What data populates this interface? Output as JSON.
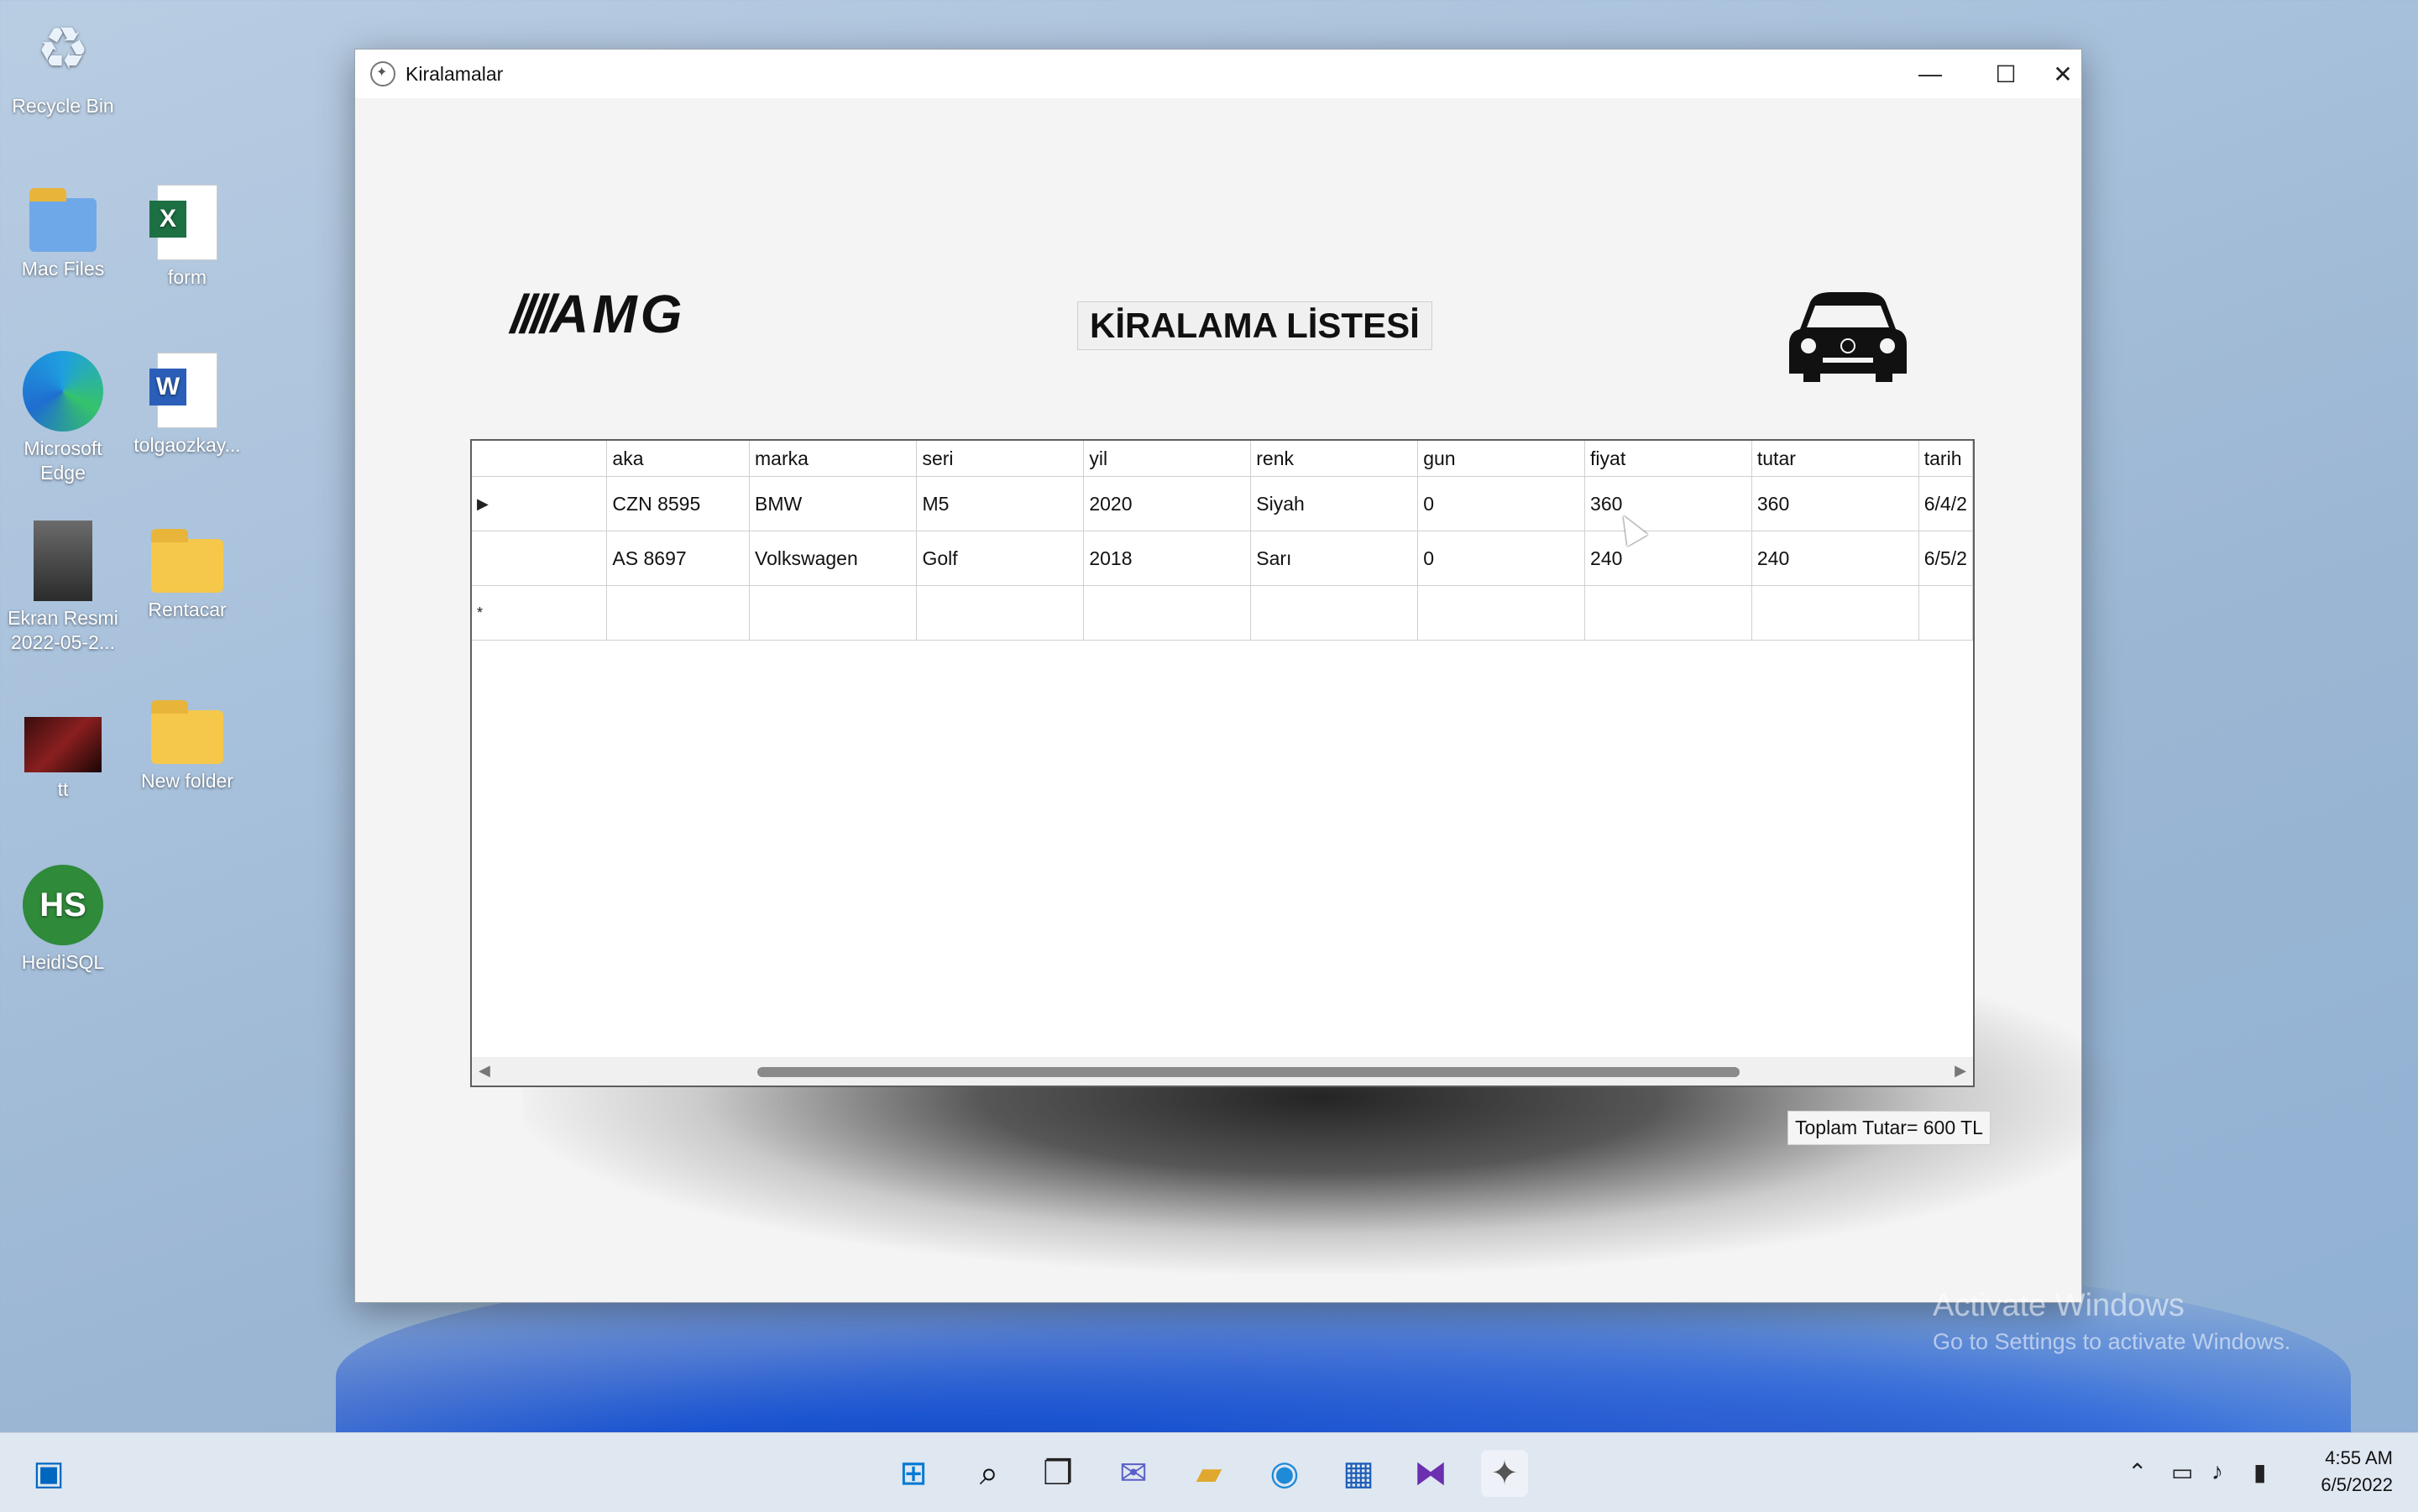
{
  "desktop": {
    "icons": [
      {
        "label": "Recycle Bin",
        "icon": "recycle-bin-icon"
      },
      {
        "label": "Mac Files",
        "icon": "folder-icon"
      },
      {
        "label": "form",
        "icon": "excel-file-icon"
      },
      {
        "label": "Microsoft Edge",
        "icon": "edge-icon"
      },
      {
        "label": "tolgaozkay...",
        "icon": "word-file-icon"
      },
      {
        "label": "Ekran Resmi 2022-05-2...",
        "icon": "image-file-icon"
      },
      {
        "label": "Rentacar",
        "icon": "folder-icon"
      },
      {
        "label": "tt",
        "icon": "image-file-icon"
      },
      {
        "label": "New folder",
        "icon": "folder-icon"
      },
      {
        "label": "HeidiSQL",
        "icon": "heidisql-icon"
      }
    ]
  },
  "window": {
    "title": "Kiralamalar",
    "heading": "KİRALAMA LİSTESİ",
    "logo_text": "AMG",
    "total_label": "Toplam Tutar= 600 TL"
  },
  "grid": {
    "columns": [
      "aka",
      "marka",
      "seri",
      "yil",
      "renk",
      "gun",
      "fiyat",
      "tutar",
      "tarih"
    ],
    "rows": [
      {
        "marker": "▶",
        "cells": [
          "CZN 8595",
          "BMW",
          "M5",
          "2020",
          "Siyah",
          "0",
          "360",
          "360",
          "6/4/2"
        ]
      },
      {
        "marker": "",
        "cells": [
          "AS 8697",
          "Volkswagen",
          "Golf",
          "2018",
          "Sarı",
          "0",
          "240",
          "240",
          "6/5/2"
        ]
      },
      {
        "marker": "*",
        "cells": [
          "",
          "",
          "",
          "",
          "",
          "",
          "",
          "",
          ""
        ]
      }
    ]
  },
  "watermark": {
    "line1": "Activate Windows",
    "line2": "Go to Settings to activate Windows."
  },
  "taskbar": {
    "time": "4:55 AM",
    "date": "6/5/2022"
  },
  "colors": {
    "accent": "#0067c0",
    "window_bg": "#f4f4f4",
    "grid_border": "#5e5e5e"
  }
}
